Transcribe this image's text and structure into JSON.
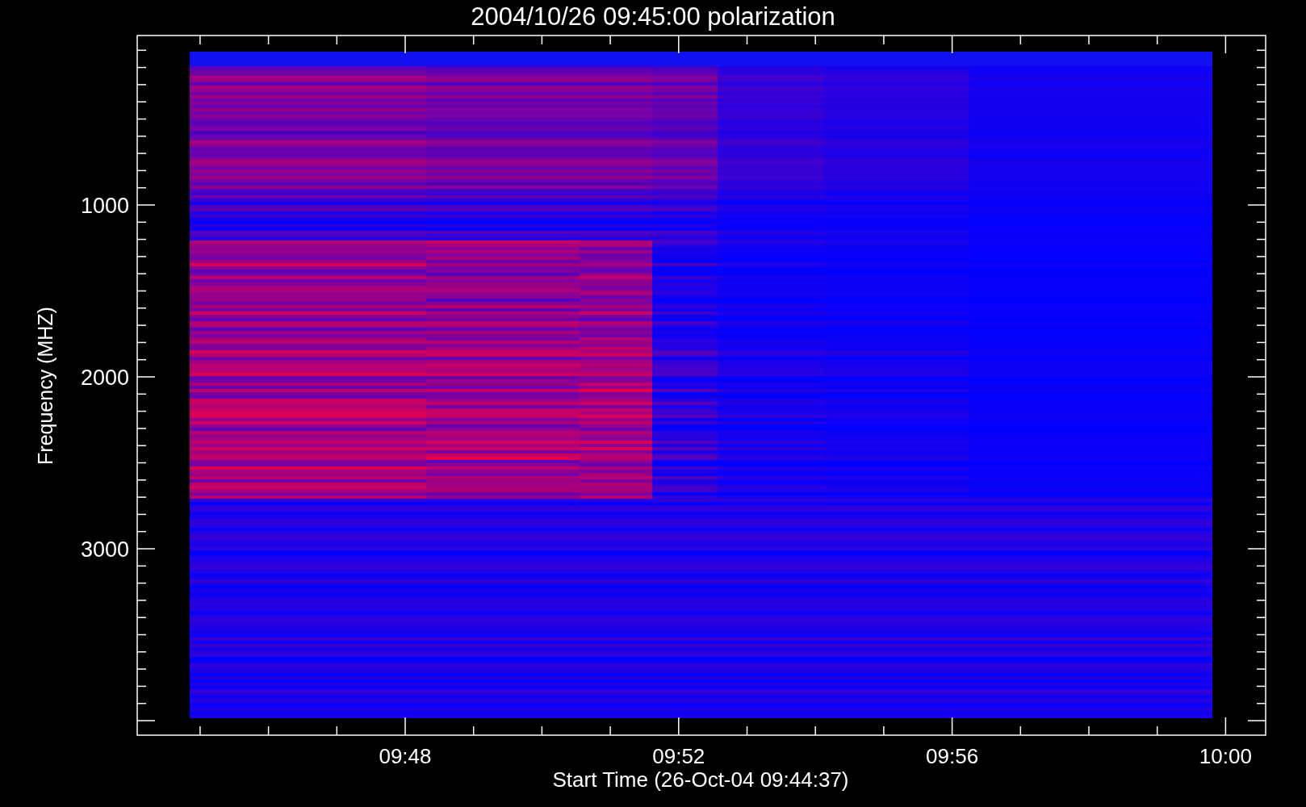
{
  "title": "2004/10/26 09:45:00 polarization",
  "y_axis": {
    "label": "Frequency (MHZ)",
    "ticks": [
      "1000",
      "2000",
      "3000"
    ]
  },
  "x_axis": {
    "label": "Start Time (26-Oct-04 09:44:37)",
    "ticks": [
      "09:48",
      "09:52",
      "09:56",
      "10:00"
    ]
  }
}
